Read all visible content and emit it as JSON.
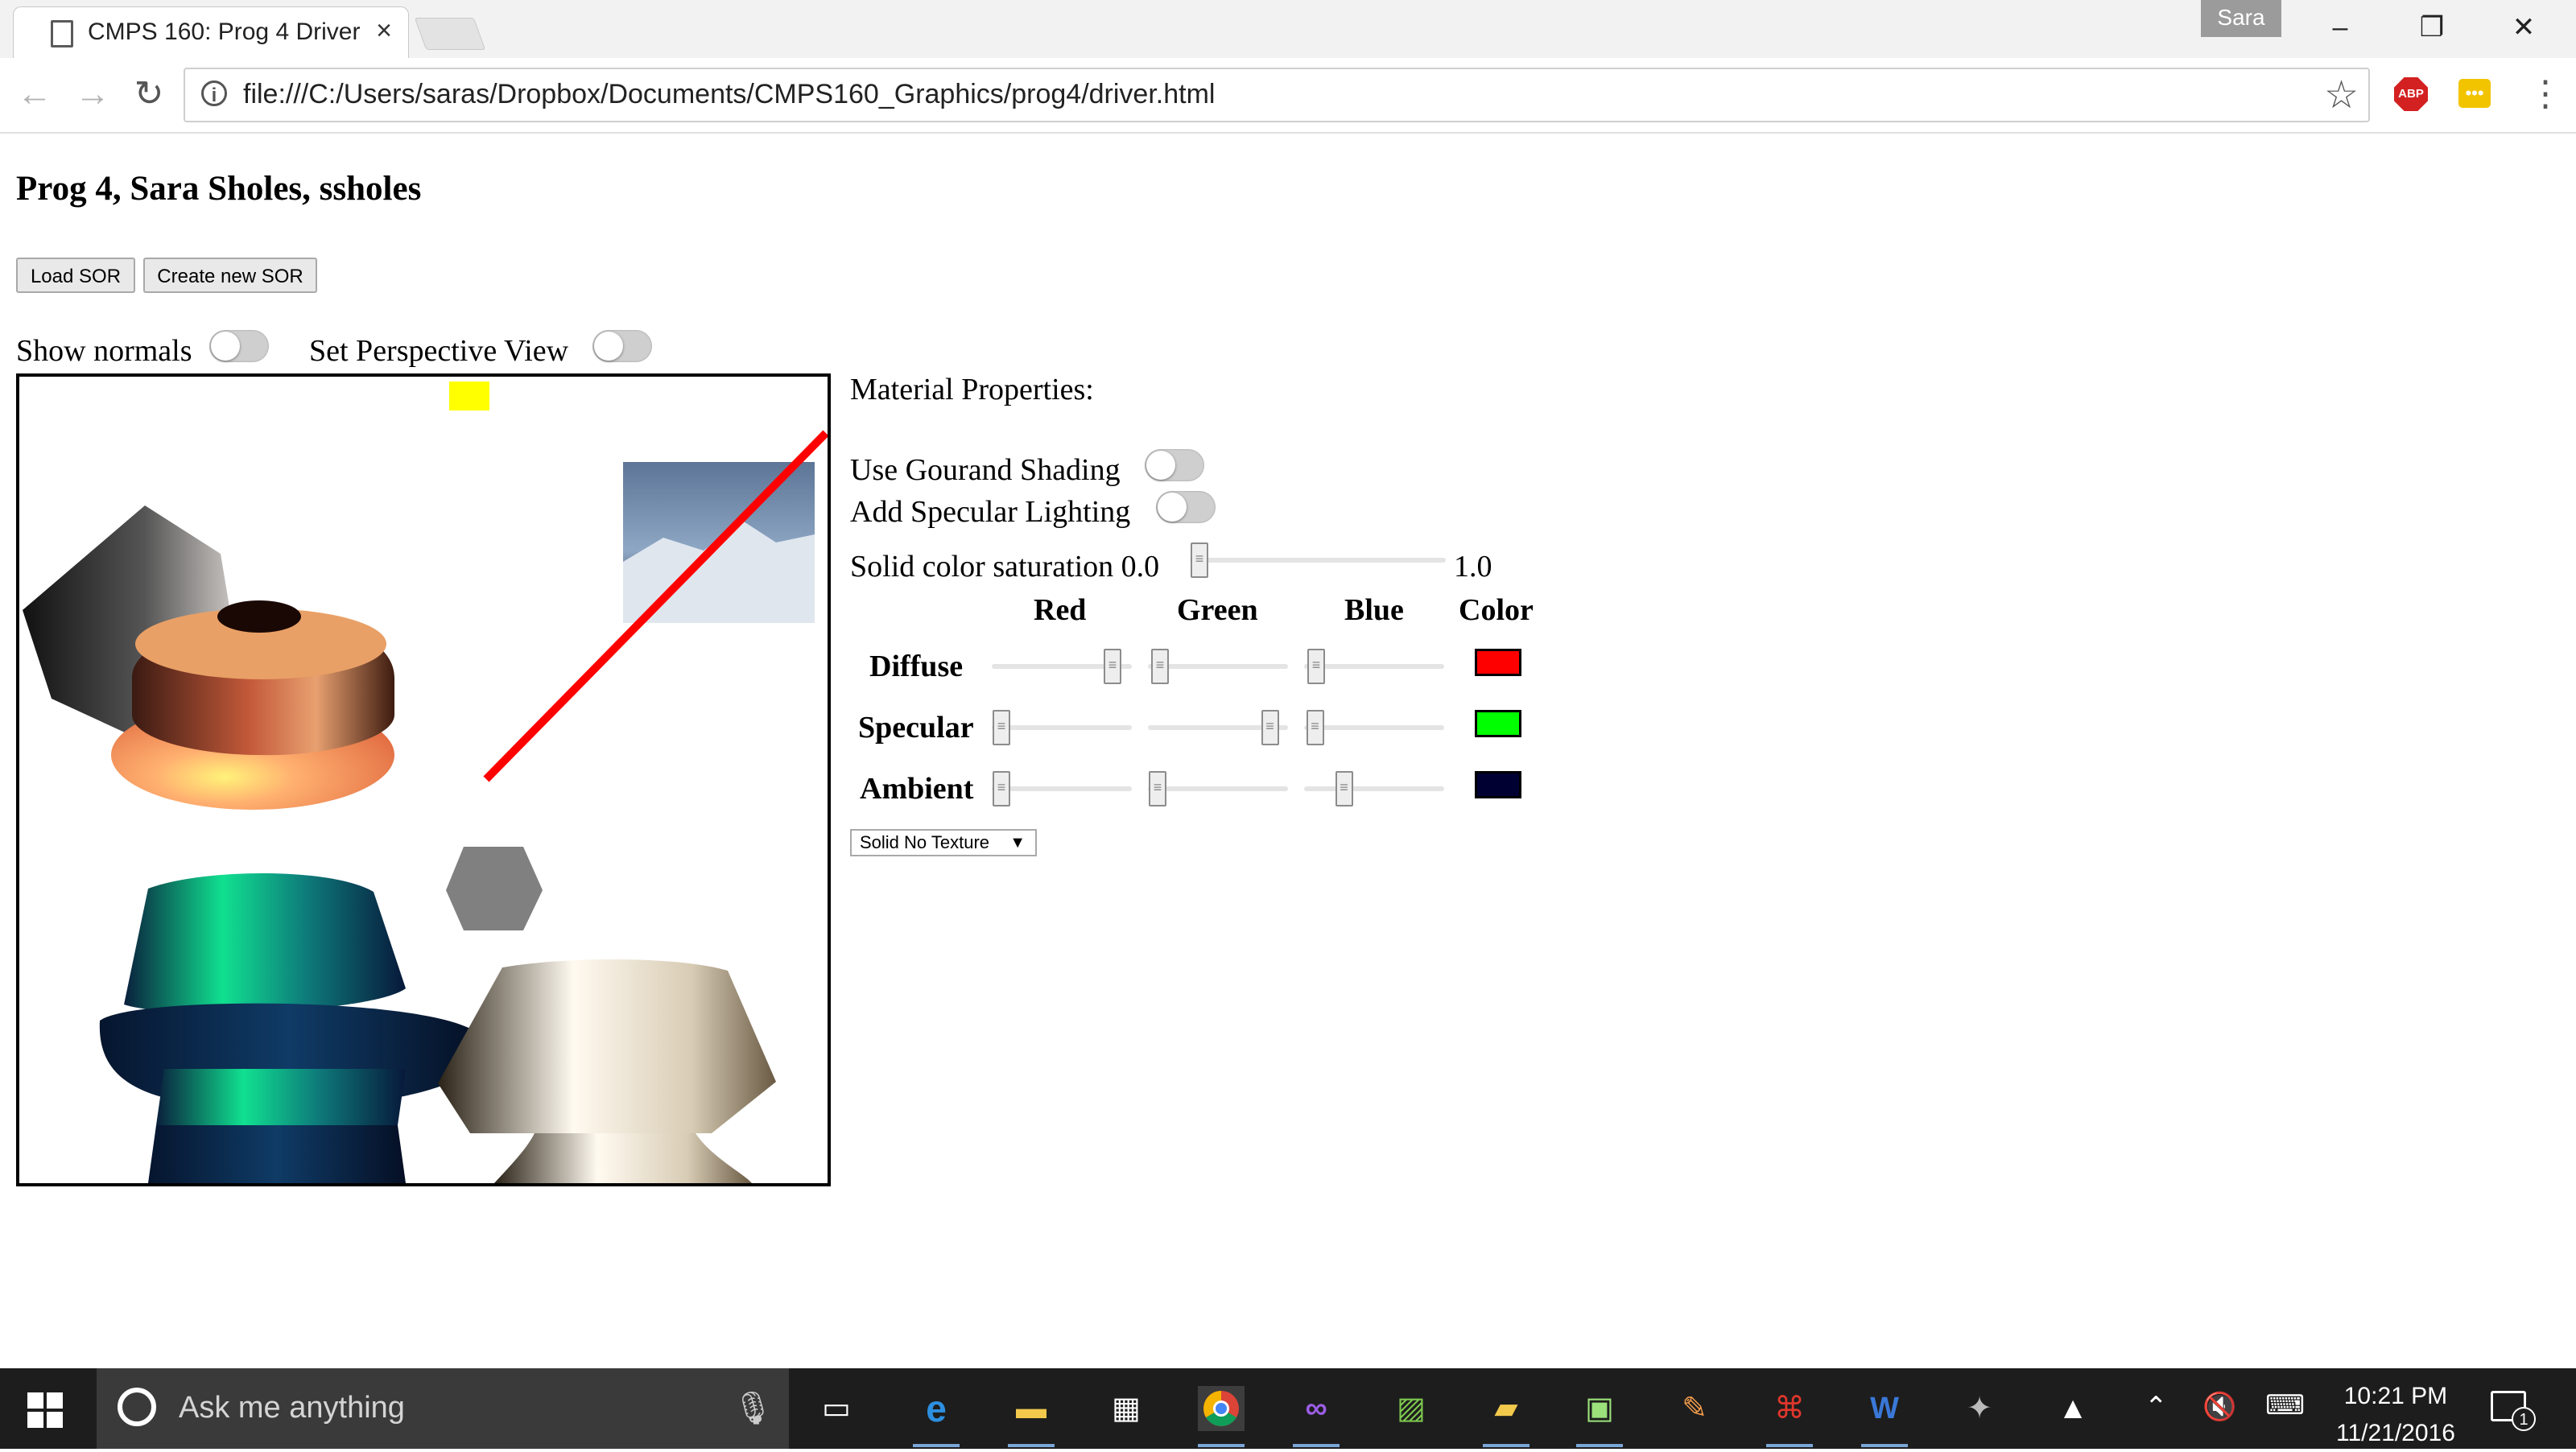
{
  "browser": {
    "tab_title": "CMPS 160: Prog 4 Driver",
    "tab_close": "×",
    "user_name": "Sara",
    "url": "file:///C:/Users/saras/Dropbox/Documents/CMPS160_Graphics/prog4/driver.html",
    "extension_abp": "ABP",
    "extension_dots": "•••"
  },
  "page": {
    "title": "Prog 4, Sara Sholes, ssholes",
    "load_button": "Load SOR",
    "create_button": "Create new SOR",
    "show_normals_label": "Show normals",
    "show_normals_on": false,
    "perspective_label": "Set Perspective View",
    "perspective_on": false
  },
  "material": {
    "heading": "Material Properties:",
    "gouraud_label": "Use Gourand Shading",
    "gouraud_on": false,
    "specular_label": "Add Specular Lighting",
    "specular_on": false,
    "saturation_label": "Solid color saturation 0.0",
    "saturation_max_label": "1.0",
    "saturation_value": 0.0,
    "columns": [
      "Red",
      "Green",
      "Blue",
      "Color"
    ],
    "rows": [
      {
        "label": "Diffuse",
        "red": 0.92,
        "green": 0.02,
        "blue": 0.02,
        "color": "#ff0000"
      },
      {
        "label": "Specular",
        "red": 0.0,
        "green": 0.93,
        "blue": 0.01,
        "color": "#00ff00"
      },
      {
        "label": "Ambient",
        "red": 0.0,
        "green": 0.0,
        "blue": 0.25,
        "color": "#000033"
      }
    ],
    "texture_select": "Solid No Texture"
  },
  "taskbar": {
    "search_placeholder": "Ask me anything",
    "time": "10:21 PM",
    "date": "11/21/2016",
    "notification_count": "1"
  }
}
